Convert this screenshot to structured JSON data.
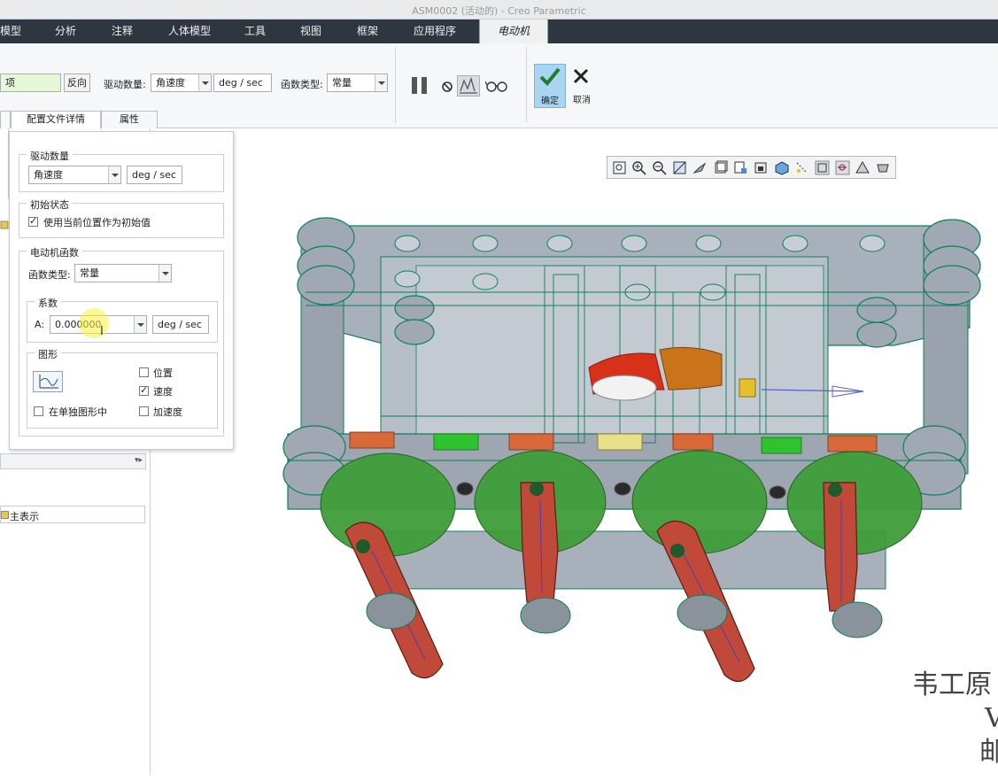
{
  "window": {
    "title": "ASM0002 (活动的) - Creo Parametric"
  },
  "menu_tabs": [
    "模型",
    "分析",
    "注释",
    "人体模型",
    "工具",
    "视图",
    "框架",
    "应用程序",
    "电动机"
  ],
  "ribbon": {
    "selection_value": "项",
    "reverse_label": "反向",
    "drive_qty_label": "驱动数量:",
    "drive_qty_value": "角速度",
    "unit": "deg / sec",
    "func_type_label": "函数类型:",
    "func_type_value": "常量",
    "ok_label": "确定",
    "cancel_label": "取消",
    "subtabs": [
      "配置文件详情",
      "属性"
    ]
  },
  "popup": {
    "drive_qty_title": "驱动数量",
    "drive_qty_value": "角速度",
    "drive_qty_unit": "deg / sec",
    "init_state_title": "初始状态",
    "init_state_checkbox": "使用当前位置作为初始值",
    "init_state_checked": true,
    "motor_func_title": "电动机函数",
    "func_type_label": "函数类型:",
    "func_type_value": "常量",
    "coeff_title": "系数",
    "coeff_a_label": "A:",
    "coeff_a_value": "0.000000",
    "coeff_unit": "deg / sec",
    "graph_title": "图形",
    "position_label": "位置",
    "position_checked": false,
    "velocity_label": "速度",
    "velocity_checked": true,
    "accel_label": "加速度",
    "accel_checked": false,
    "separate_graph_label": "在单独图形中",
    "separate_graph_checked": false
  },
  "left_panel": {
    "main_rep_label": "主表示"
  },
  "watermark": {
    "line1": "韦工原",
    "line2": "V",
    "line3": "邮"
  },
  "colors": {
    "accent_green": "#e6f8d8",
    "ok_button_bg": "#a9d4f2",
    "model_gray": "#9aa3ad",
    "wire_green": "#0f7f58",
    "gear_red": "#d8311a",
    "disc_green": "#3f9e3a",
    "link_red": "#c0493a"
  }
}
